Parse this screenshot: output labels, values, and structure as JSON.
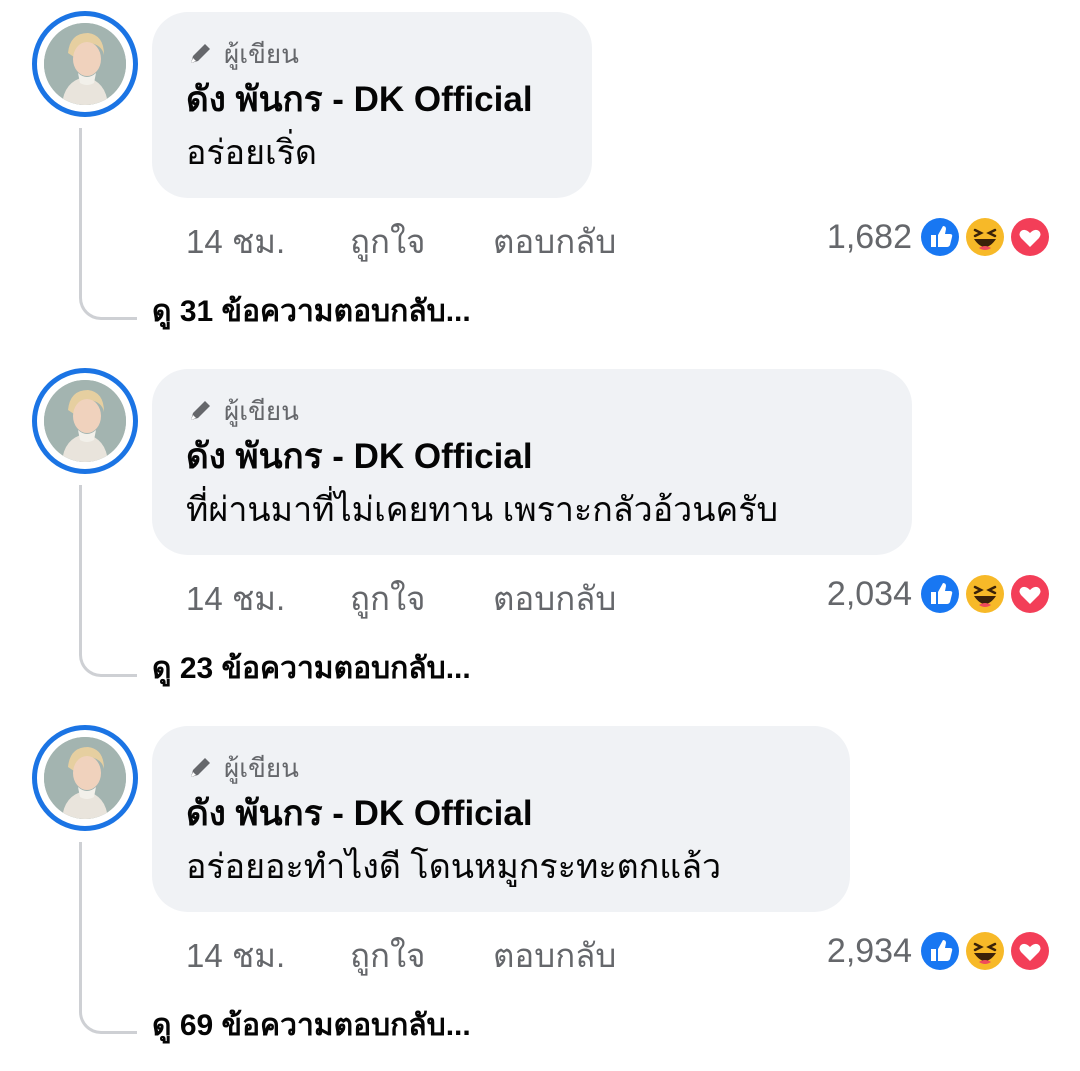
{
  "comments": [
    {
      "badge": "ผู้เขียน",
      "author": "ดัง พันกร - DK Official",
      "text": "อร่อยเริ่ด",
      "time": "14 ชม.",
      "like_label": "ถูกใจ",
      "reply_label": "ตอบกลับ",
      "reaction_count": "1,682",
      "view_replies": "ดู 31 ข้อความตอบกลับ..."
    },
    {
      "badge": "ผู้เขียน",
      "author": "ดัง พันกร - DK Official",
      "text": "ที่ผ่านมาที่ไม่เคยทาน เพราะกลัวอ้วนครับ",
      "time": "14 ชม.",
      "like_label": "ถูกใจ",
      "reply_label": "ตอบกลับ",
      "reaction_count": "2,034",
      "view_replies": "ดู 23 ข้อความตอบกลับ..."
    },
    {
      "badge": "ผู้เขียน",
      "author": "ดัง พันกร - DK Official",
      "text": "อร่อยอะทำไงดี โดนหมูกระทะตกแล้ว",
      "time": "14 ชม.",
      "like_label": "ถูกใจ",
      "reply_label": "ตอบกลับ",
      "reaction_count": "2,934",
      "view_replies": "ดู 69 ข้อความตอบกลับ..."
    }
  ],
  "icons": {
    "author_badge": "pencil-icon",
    "reactions": [
      "like-icon",
      "haha-icon",
      "love-icon"
    ]
  },
  "colors": {
    "accent": "#1b74e4",
    "bubble": "#f0f2f5",
    "secondary_text": "#65676b",
    "like": "#1877f2",
    "haha": "#f7b928",
    "love": "#f33e58"
  }
}
